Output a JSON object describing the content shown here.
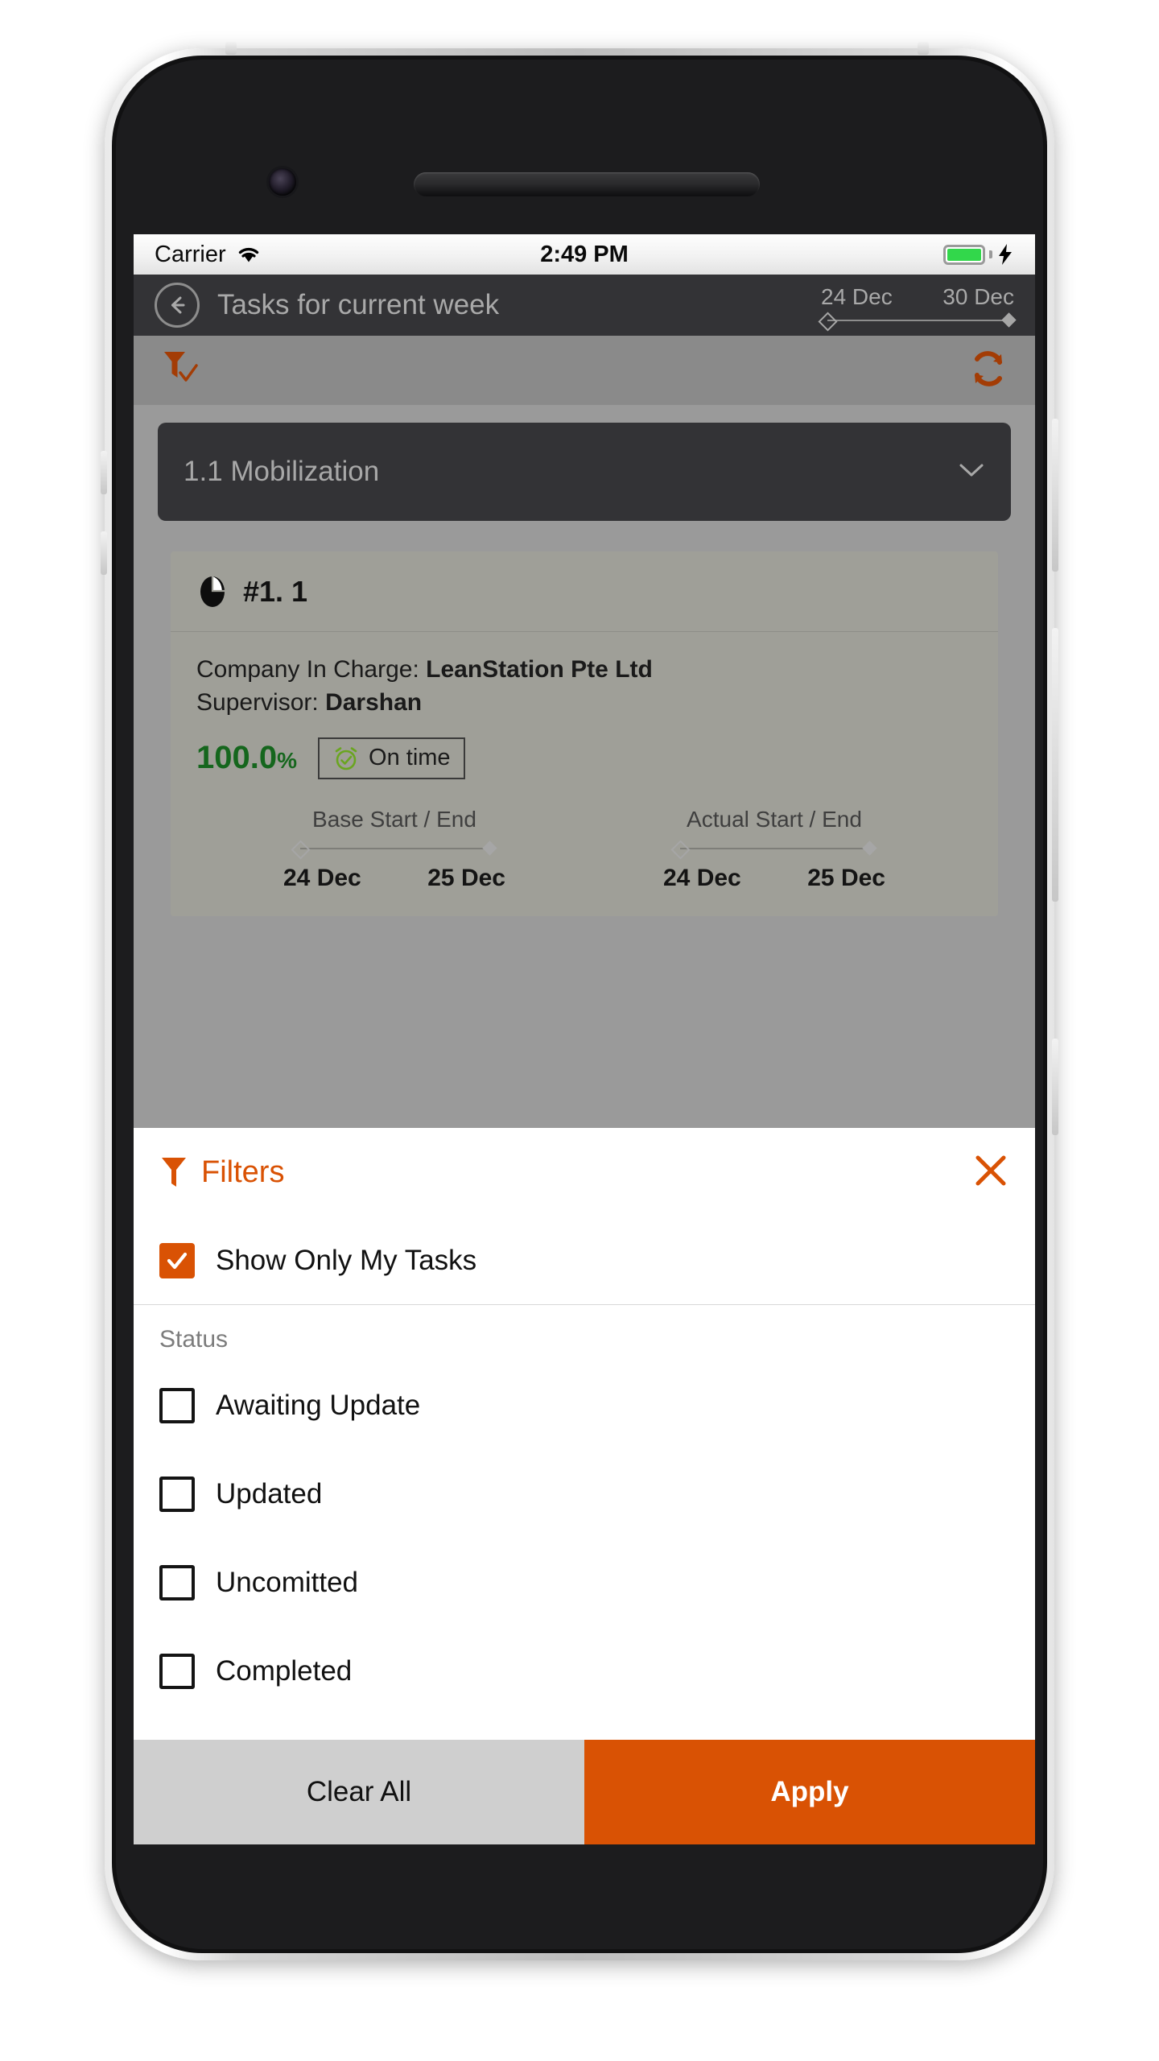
{
  "status_bar": {
    "carrier": "Carrier",
    "time": "2:49 PM",
    "wifi_icon": "wifi-icon",
    "battery_icon": "battery-full-icon",
    "charging_icon": "lightning-bolt-icon"
  },
  "nav": {
    "back_icon": "back-arrow-icon",
    "title": "Tasks for current week",
    "range_start": "24 Dec",
    "range_end": "30 Dec"
  },
  "toolbar": {
    "filter_icon": "filter-check-icon",
    "refresh_icon": "refresh-icon"
  },
  "group": {
    "title": "1.1 Mobilization",
    "chevron_icon": "chevron-down-icon"
  },
  "task": {
    "pie_icon": "pie-chart-icon",
    "id": "#1. 1",
    "company_label": "Company In Charge: ",
    "company_value": "LeanStation Pte Ltd",
    "supervisor_label": "Supervisor: ",
    "supervisor_value": "Darshan",
    "progress": "100.0",
    "progress_unit": "%",
    "ontime_icon": "alarm-check-icon",
    "ontime_label": "On time",
    "base_title": "Base Start / End",
    "base_start": "24 Dec",
    "base_end": "25 Dec",
    "actual_title": "Actual Start / End",
    "actual_start": "24 Dec",
    "actual_end": "25 Dec"
  },
  "filters": {
    "icon": "filter-icon",
    "title": "Filters",
    "close_icon": "close-icon",
    "my_tasks_label": "Show Only My Tasks",
    "my_tasks_checked": true,
    "status_section_title": "Status",
    "status_options": [
      {
        "label": "Awaiting Update",
        "checked": false
      },
      {
        "label": "Updated",
        "checked": false
      },
      {
        "label": "Uncomitted",
        "checked": false
      },
      {
        "label": "Completed",
        "checked": false
      }
    ],
    "clear_all_label": "Clear All",
    "apply_label": "Apply"
  },
  "colors": {
    "accent_orange": "#d95204",
    "progress_green": "#15661d",
    "nav_dark": "#333336",
    "dim_overlay": "#9a9a9a"
  }
}
